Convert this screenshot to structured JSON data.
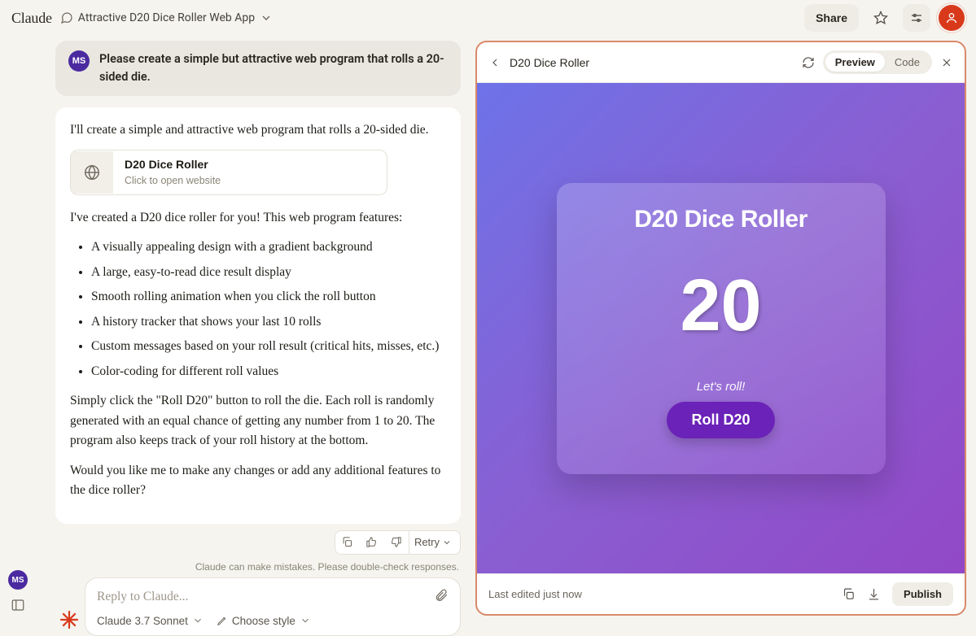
{
  "header": {
    "logo": "Claude",
    "chat_title": "Attractive D20 Dice Roller Web App",
    "share_label": "Share"
  },
  "user_message": {
    "initials": "MS",
    "text": "Please create a simple but attractive web program that rolls a 20-sided die."
  },
  "assistant": {
    "intro": "I'll create a simple and attractive web program that rolls a 20-sided die.",
    "artifact_card": {
      "title": "D20 Dice Roller",
      "subtitle": "Click to open website"
    },
    "features_lead": "I've created a D20 dice roller for you! This web program features:",
    "features": [
      "A visually appealing design with a gradient background",
      "A large, easy-to-read dice result display",
      "Smooth rolling animation when you click the roll button",
      "A history tracker that shows your last 10 rolls",
      "Custom messages based on your roll result (critical hits, misses, etc.)",
      "Color-coding for different roll values"
    ],
    "para2": "Simply click the \"Roll D20\" button to roll the die. Each roll is randomly generated with an equal chance of getting any number from 1 to 20. The program also keeps track of your roll history at the bottom.",
    "para3": "Would you like me to make any changes or add any additional features to the dice roller?"
  },
  "message_actions": {
    "retry": "Retry"
  },
  "disclaimer": "Claude can make mistakes. Please double-check responses.",
  "composer": {
    "placeholder": "Reply to Claude...",
    "model": "Claude 3.7 Sonnet",
    "style": "Choose style"
  },
  "artifact_panel": {
    "title": "D20 Dice Roller",
    "tabs": {
      "preview": "Preview",
      "code": "Code"
    },
    "footer_status": "Last edited just now",
    "publish": "Publish"
  },
  "preview_app": {
    "heading": "D20 Dice Roller",
    "value": "20",
    "tagline": "Let's roll!",
    "button": "Roll D20"
  },
  "bottom_left": {
    "initials": "MS"
  }
}
